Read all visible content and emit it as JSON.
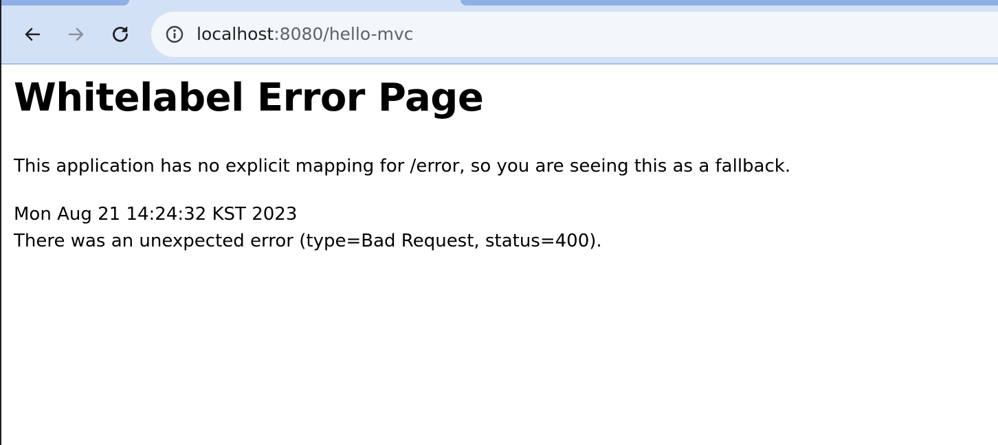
{
  "browser": {
    "url_host": "localhost",
    "url_rest": ":8080/hello-mvc",
    "icons": {
      "back": "back-arrow-icon",
      "forward": "forward-arrow-icon",
      "reload": "reload-icon",
      "site_info": "info-icon"
    }
  },
  "page": {
    "heading": "Whitelabel Error Page",
    "explanation": "This application has no explicit mapping for /error, so you are seeing this as a fallback.",
    "timestamp": "Mon Aug 21 14:24:32 KST 2023",
    "error_message": "There was an unexpected error (type=Bad Request, status=400)."
  },
  "colors": {
    "toolbar_bg": "#d3e1f7",
    "omnibox_bg": "#f3f6fb",
    "text": "#000000"
  }
}
